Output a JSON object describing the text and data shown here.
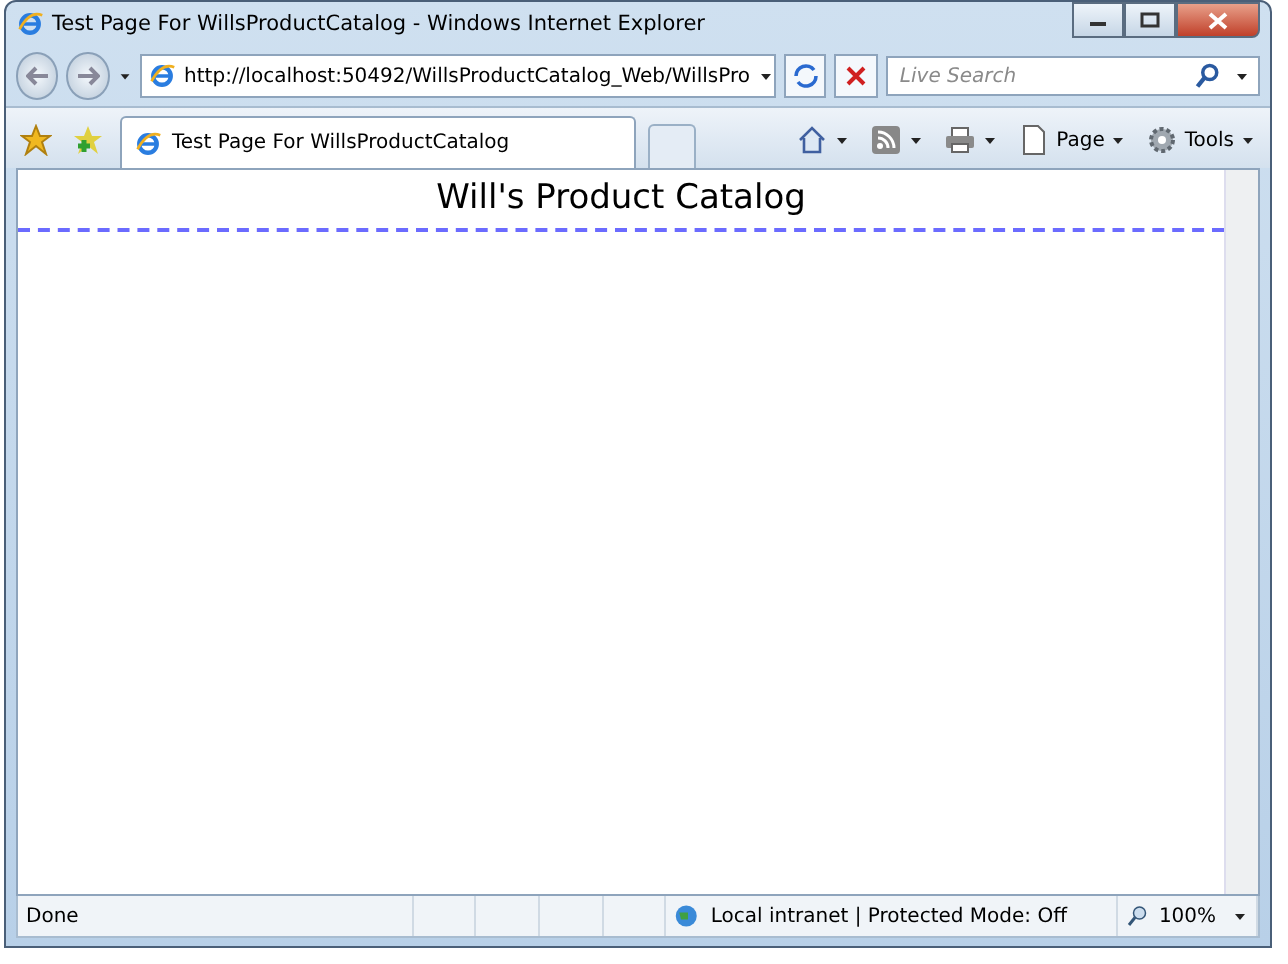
{
  "window": {
    "title": "Test Page For WillsProductCatalog - Windows Internet Explorer"
  },
  "address_bar": {
    "url": "http://localhost:50492/WillsProductCatalog_Web/WillsPro"
  },
  "search": {
    "placeholder": "Live Search"
  },
  "tabs": [
    {
      "label": "Test Page For WillsProductCatalog",
      "selected": true
    }
  ],
  "command_bar": {
    "page": "Page",
    "tools": "Tools"
  },
  "page": {
    "heading": "Will's Product Catalog"
  },
  "status_bar": {
    "text": "Done",
    "zone": "Local intranet | Protected Mode: Off",
    "zoom": "100%"
  }
}
